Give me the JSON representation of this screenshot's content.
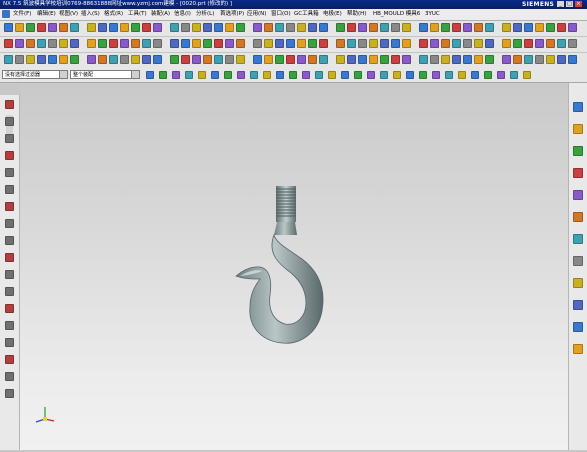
{
  "window": {
    "title": "NX 7.5 筑波模具学校培训0769-88631888网址www.yzmj.com建模 - [0020.prt (修改的) ]",
    "brand": "SIEMENS",
    "controls": [
      "_",
      "□",
      "×"
    ]
  },
  "menu": {
    "items": [
      "文件(F)",
      "编辑(E)",
      "视图(V)",
      "插入(S)",
      "格式(R)",
      "工具(T)",
      "装配(A)",
      "信息(I)",
      "分析(L)",
      "首选项(P)",
      "应用(N)",
      "窗口(O)",
      "GC工具箱",
      "电极(E)",
      "帮助(H)",
      "HB_MOULD 模具6",
      "3YUC"
    ]
  },
  "filter": {
    "type_filter": "没有选择过滤器",
    "scope": "整个装配"
  },
  "viewport": {
    "model": "hook",
    "triad_icon": "wcs-triad-icon"
  },
  "colors": {
    "title_bg": "#0a2a8a",
    "toolbar_bg": "#e6e6e6",
    "viewport_top": "#c9c9c9",
    "viewport_bottom": "#f1f1f1",
    "model": "#8a9a9c"
  },
  "icons": {
    "left": [
      "part-navigator-icon",
      "sketch-icon",
      "line-icon",
      "arc-icon",
      "circle-icon",
      "fillet-icon",
      "chamfer-icon",
      "rectangle-icon",
      "polygon-icon",
      "point-icon",
      "offset-icon",
      "trim-icon",
      "extend-icon",
      "mirror-icon",
      "constraint-icon",
      "dimension-icon",
      "show-hide-icon",
      "finish-sketch-icon"
    ],
    "right": [
      "assembly-navigator-icon",
      "constraint-navigator-icon",
      "part-navigator-icon",
      "reuse-library-icon",
      "web-browser-icon",
      "history-icon",
      "system-materials-icon",
      "process-studio-icon",
      "roles-icon",
      "system-scenes-icon",
      "visualization-icon",
      "palette-icon"
    ]
  }
}
